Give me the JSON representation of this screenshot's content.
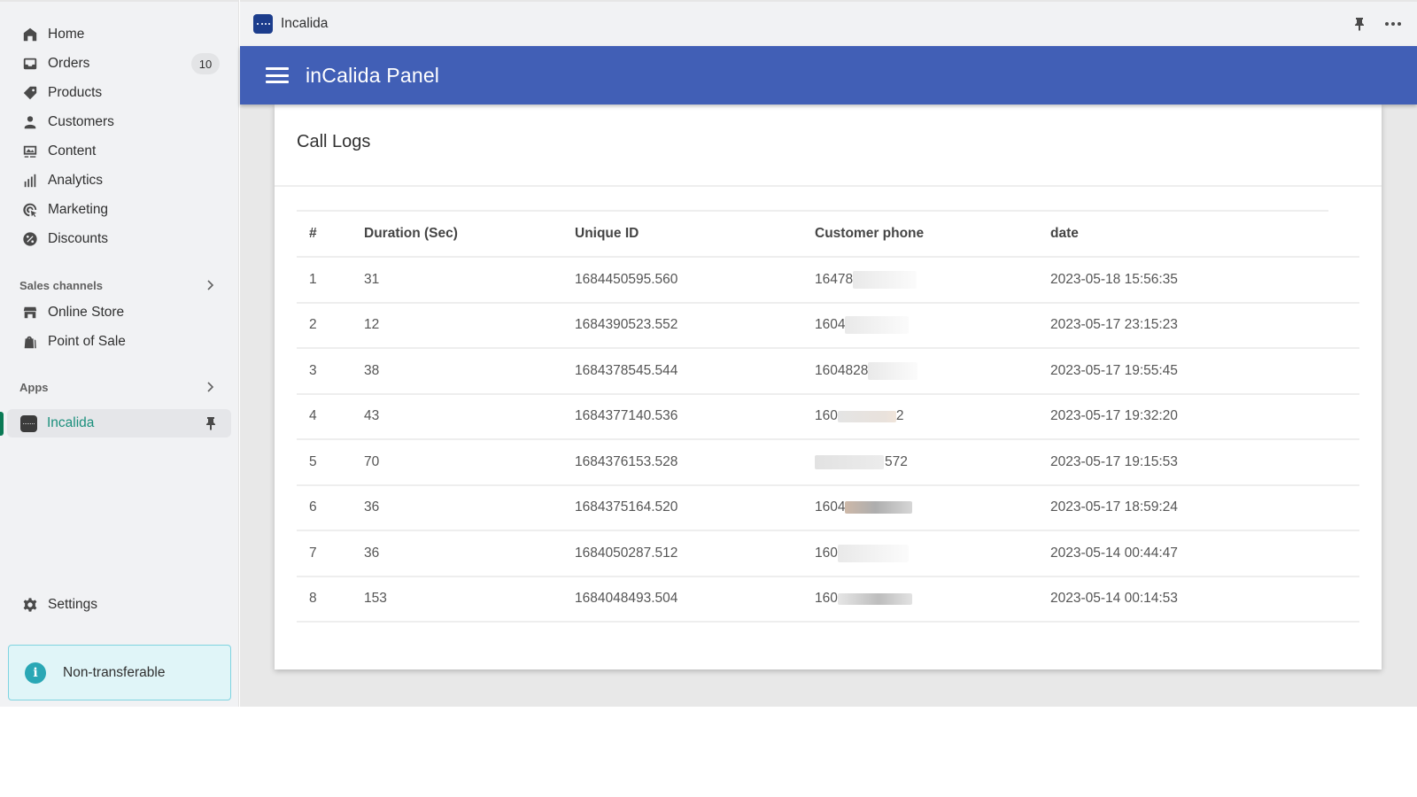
{
  "sidebar": {
    "nav": [
      {
        "label": "Home",
        "icon": "home-icon"
      },
      {
        "label": "Orders",
        "icon": "inbox-icon",
        "badge": "10"
      },
      {
        "label": "Products",
        "icon": "tag-icon"
      },
      {
        "label": "Customers",
        "icon": "person-icon"
      },
      {
        "label": "Content",
        "icon": "image-icon"
      },
      {
        "label": "Analytics",
        "icon": "bar-chart-icon"
      },
      {
        "label": "Marketing",
        "icon": "target-icon"
      },
      {
        "label": "Discounts",
        "icon": "discount-icon"
      }
    ],
    "sales_channels": {
      "label": "Sales channels",
      "items": [
        {
          "label": "Online Store",
          "icon": "store-icon"
        },
        {
          "label": "Point of Sale",
          "icon": "bag-icon"
        }
      ]
    },
    "apps": {
      "label": "Apps",
      "items": [
        {
          "label": "Incalida",
          "active": true
        }
      ]
    },
    "settings_label": "Settings",
    "notice_label": "Non-transferable"
  },
  "topbar": {
    "app_name": "Incalida"
  },
  "appbar": {
    "title": "inCalida Panel"
  },
  "card": {
    "title": "Call Logs",
    "table": {
      "headers": [
        "#",
        "Duration (Sec)",
        "Unique ID",
        "Customer phone",
        "date"
      ],
      "rows": [
        {
          "n": "1",
          "duration": "31",
          "uid": "1684450595.560",
          "phone_visible": "16478",
          "phone_suffix": "",
          "date": "2023-05-18 15:56:35"
        },
        {
          "n": "2",
          "duration": "12",
          "uid": "1684390523.552",
          "phone_visible": "1604",
          "phone_suffix": "",
          "date": "2023-05-17 23:15:23"
        },
        {
          "n": "3",
          "duration": "38",
          "uid": "1684378545.544",
          "phone_visible": "1604828",
          "phone_suffix": "",
          "date": "2023-05-17 19:55:45"
        },
        {
          "n": "4",
          "duration": "43",
          "uid": "1684377140.536",
          "phone_visible": "160",
          "phone_suffix": "2",
          "date": "2023-05-17 19:32:20"
        },
        {
          "n": "5",
          "duration": "70",
          "uid": "1684376153.528",
          "phone_visible": "",
          "phone_suffix": "572",
          "date": "2023-05-17 19:15:53"
        },
        {
          "n": "6",
          "duration": "36",
          "uid": "1684375164.520",
          "phone_visible": "1604",
          "phone_suffix": "",
          "date": "2023-05-17 18:59:24"
        },
        {
          "n": "7",
          "duration": "36",
          "uid": "1684050287.512",
          "phone_visible": "160",
          "phone_suffix": "",
          "date": "2023-05-14 00:44:47"
        },
        {
          "n": "8",
          "duration": "153",
          "uid": "1684048493.504",
          "phone_visible": "160",
          "phone_suffix": "",
          "date": "2023-05-14 00:14:53"
        }
      ]
    }
  },
  "colors": {
    "appbar": "#415fb6",
    "active_app": "#1a8f7c",
    "notice_bg": "#e0f5f8",
    "notice_icon": "#2aa7b5"
  }
}
